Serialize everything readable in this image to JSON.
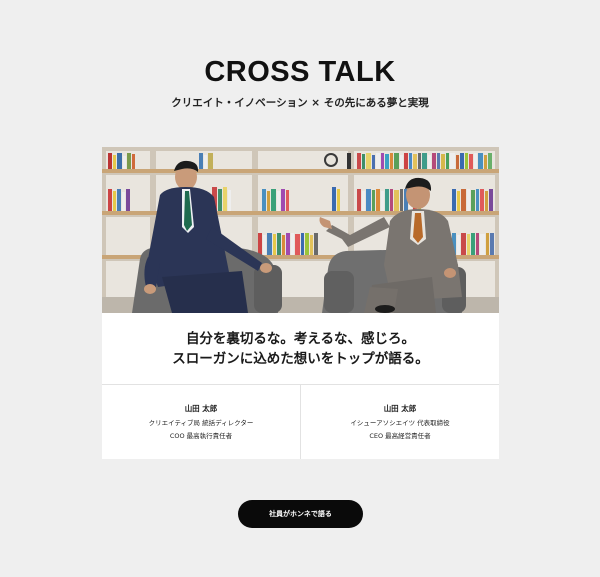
{
  "header": {
    "title": "CROSS TALK",
    "subtitle": "クリエイト・イノベーション × その先にある夢と実現"
  },
  "card": {
    "photo_alt": "photo-two-executives-talking",
    "headline_line1": "自分を裏切るな。考えるな、感じろ。",
    "headline_line2": "スローガンに込めた想いをトップが語る。",
    "profiles": [
      {
        "name": "山田 太郎",
        "role_line1": "クリエイティブ局 統括ディレクター",
        "role_line2": "COO 最高執行責任者"
      },
      {
        "name": "山田 太郎",
        "role_line1": "イシューアソシエイツ 代表取締役",
        "role_line2": "CEO 最高経営責任者"
      }
    ]
  },
  "cta": {
    "label": "社員がホンネで語る"
  },
  "colors": {
    "page_bg": "#efefef",
    "card_bg": "#ffffff",
    "cta_bg": "#0a0a0a",
    "cta_text": "#ffffff"
  }
}
